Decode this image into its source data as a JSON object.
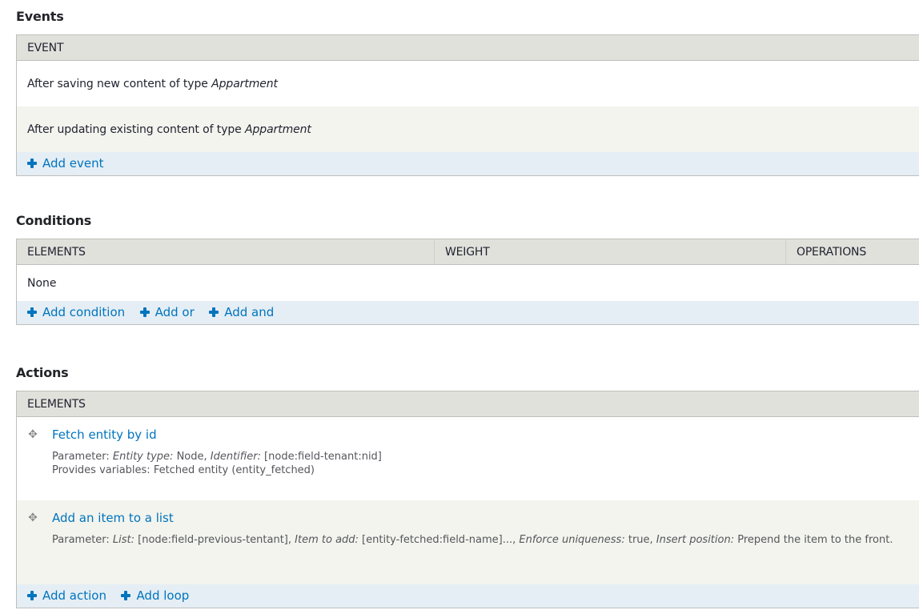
{
  "events": {
    "heading": "Events",
    "columns": [
      "EVENT"
    ],
    "rows": [
      {
        "prefix": "After saving new content of type ",
        "type": "Appartment"
      },
      {
        "prefix": "After updating existing content of type ",
        "type": "Appartment"
      }
    ],
    "footer_links": [
      "Add event"
    ]
  },
  "conditions": {
    "heading": "Conditions",
    "columns": [
      "ELEMENTS",
      "WEIGHT",
      "OPERATIONS"
    ],
    "empty_text": "None",
    "footer_links": [
      "Add condition",
      "Add or",
      "Add and"
    ]
  },
  "actions": {
    "heading": "Actions",
    "columns": [
      "ELEMENTS"
    ],
    "rows": [
      {
        "title": "Fetch entity by id",
        "param_label": "Parameter: ",
        "params": [
          {
            "name": "Entity type:",
            "value": " Node, "
          },
          {
            "name": "Identifier:",
            "value": " [node:field-tenant:nid]"
          }
        ],
        "provides": "Provides variables: Fetched entity (entity_fetched)"
      },
      {
        "title": "Add an item to a list",
        "param_label": "Parameter: ",
        "params": [
          {
            "name": "List:",
            "value": " [node:field-previous-tentant], "
          },
          {
            "name": "Item to add:",
            "value": " [entity-fetched:field-name]..., "
          },
          {
            "name": "Enforce uniqueness:",
            "value": " true, "
          },
          {
            "name": "Insert position:",
            "value": " Prepend the item to the front."
          }
        ],
        "provides": ""
      }
    ],
    "footer_links": [
      "Add action",
      "Add loop"
    ]
  }
}
